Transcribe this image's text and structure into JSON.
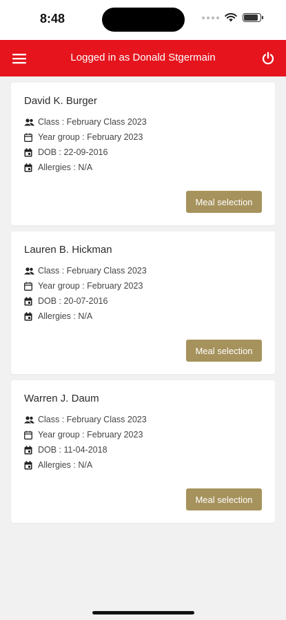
{
  "status": {
    "time": "8:48"
  },
  "header": {
    "title": "Logged in as Donald Stgermain"
  },
  "students": [
    {
      "name": "David K. Burger",
      "class": "Class : February Class 2023",
      "year_group": "Year group : February 2023",
      "dob": "DOB :  22-09-2016",
      "allergies": "Allergies : N/A",
      "button": "Meal selection"
    },
    {
      "name": "Lauren B. Hickman",
      "class": "Class : February Class 2023",
      "year_group": "Year group : February 2023",
      "dob": "DOB :  20-07-2016",
      "allergies": "Allergies : N/A",
      "button": "Meal selection"
    },
    {
      "name": "Warren J. Daum",
      "class": "Class : February Class 2023",
      "year_group": "Year group : February 2023",
      "dob": "DOB :  11-04-2018",
      "allergies": "Allergies : N/A",
      "button": "Meal selection"
    }
  ],
  "colors": {
    "header": "#e5141d",
    "button": "#a6925c",
    "background": "#f1f1f1"
  },
  "icons": {
    "class": "users-icon",
    "year_group": "calendar-icon",
    "dob": "calendar-date-icon",
    "allergies": "calendar-date-icon"
  }
}
